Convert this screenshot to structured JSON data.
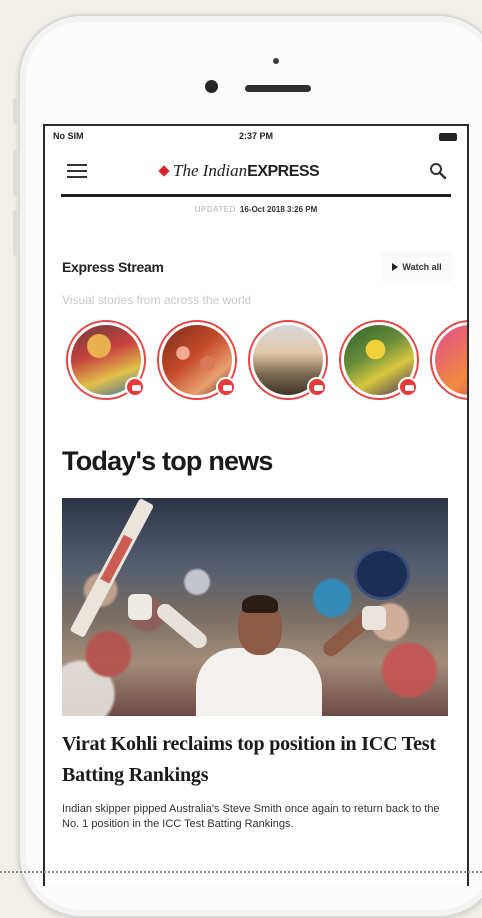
{
  "status_bar": {
    "carrier": "No SIM",
    "time": "2:37 PM"
  },
  "header": {
    "logo_part1": "The Indian",
    "logo_part2": "EXPRESS"
  },
  "updated": {
    "label": "UPDATED",
    "date": "16-Oct 2018 3:26 PM"
  },
  "stream": {
    "title": "Express Stream",
    "watch_all_label": "Watch all",
    "subtitle": "Visual stories from across the world",
    "items": [
      {
        "name": "story-1"
      },
      {
        "name": "story-2"
      },
      {
        "name": "story-3"
      },
      {
        "name": "story-4"
      },
      {
        "name": "story-5"
      }
    ]
  },
  "top_news": {
    "heading": "Today's top news",
    "article": {
      "headline": "Virat Kohli reclaims top position in ICC Test Batting Rankings",
      "summary": "Indian skipper pipped Australia's Steve Smith once again to return back to the No. 1 position in the ICC Test Batting Rankings."
    }
  },
  "colors": {
    "accent": "#d8232a",
    "story_ring": "#e94545"
  }
}
